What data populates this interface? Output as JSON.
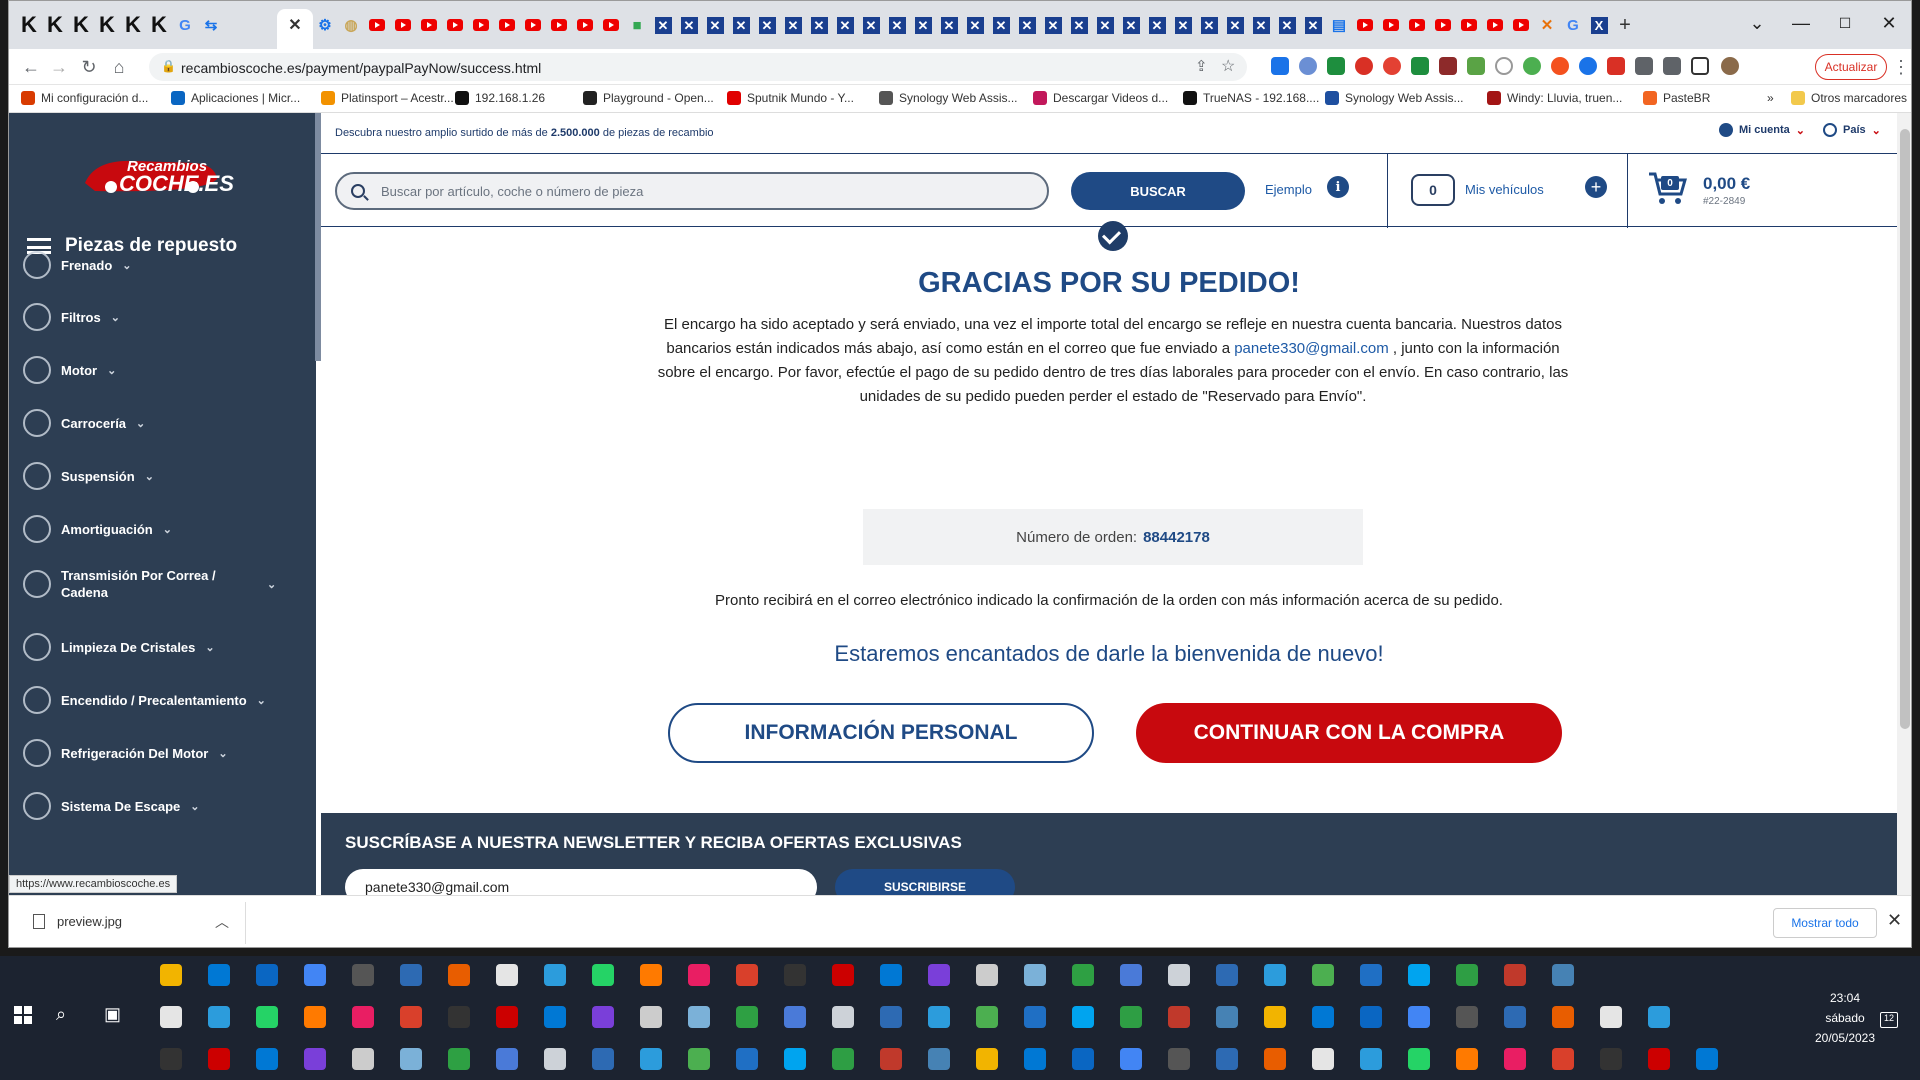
{
  "browser": {
    "url": "recambioscoche.es/payment/paypalPayNow/success.html",
    "update_label": "Actualizar",
    "bookmarks": [
      {
        "label": "Mi configuración d...",
        "color": "#d83b01"
      },
      {
        "label": "Aplicaciones | Micr...",
        "color": "#0a66c2"
      },
      {
        "label": "Platinsport – Acestr...",
        "color": "#f29200"
      },
      {
        "label": "192.168.1.26",
        "color": "#111111"
      },
      {
        "label": "Playground - Open...",
        "color": "#222222"
      },
      {
        "label": "Sputnik Mundo - Y...",
        "color": "#e00000"
      },
      {
        "label": "Synology Web Assis...",
        "color": "#555555"
      },
      {
        "label": "Descargar Videos d...",
        "color": "#c2185b"
      },
      {
        "label": "TrueNAS - 192.168....",
        "color": "#111111"
      },
      {
        "label": "Synology Web Assis...",
        "color": "#1e4fa0"
      },
      {
        "label": "Windy: Lluvia, truen...",
        "color": "#a31515"
      },
      {
        "label": "PasteBR",
        "color": "#f26522"
      }
    ],
    "other_bookmarks": "Otros marcadores",
    "more_bookmarks": "»",
    "status_url": "https://www.recambioscoche.es",
    "download_file": "preview.jpg",
    "show_all": "Mostrar todo"
  },
  "site": {
    "logo_top": "Recambios",
    "logo_bottom": "COCHE.ES",
    "promo_prefix": "Descubra nuestro amplio surtido de más de ",
    "promo_bold": "2.500.000",
    "promo_suffix": " de piezas de recambio",
    "account": "Mi cuenta",
    "country": "País",
    "search_placeholder": "Buscar por artículo, coche o número de pieza",
    "search_button": "BUSCAR",
    "example": "Ejemplo",
    "vehicles_count": "0",
    "vehicles_label": "Mis vehículos",
    "cart_count": "0",
    "cart_total": "0,00 €",
    "cart_id": "#22-2849"
  },
  "sidebar": {
    "title": "Piezas de repuesto",
    "items": [
      {
        "label": "Frenado"
      },
      {
        "label": "Filtros"
      },
      {
        "label": "Motor"
      },
      {
        "label": "Carrocería"
      },
      {
        "label": "Suspensión"
      },
      {
        "label": "Amortiguación"
      },
      {
        "label": "Transmisión Por Correa / Cadena"
      },
      {
        "label": "Limpieza De Cristales"
      },
      {
        "label": "Encendido / Precalentamiento"
      },
      {
        "label": "Refrigeración Del Motor"
      },
      {
        "label": "Sistema De Escape"
      }
    ]
  },
  "success": {
    "title": "GRACIAS POR SU PEDIDO!",
    "message_part1": "El encargo ha sido aceptado y será enviado, una vez el importe total del encargo se refleje en nuestra cuenta bancaria. Nuestros datos bancarios están indicados más abajo, así como están en el correo que fue enviado a ",
    "email": "panete330@gmail.com",
    "message_part2": " , junto con la información sobre el encargo. Por favor, efectúe el pago de su pedido dentro de tres días laborales para proceder con el envío. En caso contrario, las unidades de su pedido pueden perder el estado de \"Reservado para Envío\".",
    "order_label": "Número de orden:",
    "order_number": "88442178",
    "confirmation": "Pronto recibirá en el correo electrónico indicado la confirmación de la orden con más información acerca de su pedido.",
    "welcome": "Estaremos encantados de darle la bienvenida de nuevo!",
    "btn_personal": "INFORMACIÓN PERSONAL",
    "btn_continue": "CONTINUAR CON LA COMPRA"
  },
  "newsletter": {
    "title": "SUSCRÍBASE A NUESTRA NEWSLETTER Y RECIBA OFERTAS EXCLUSIVAS",
    "email_value": "panete330@gmail.com",
    "button": "SUSCRIBIRSE"
  },
  "taskbar": {
    "time": "23:04",
    "day": "sábado",
    "date": "20/05/2023",
    "notifications": "12"
  }
}
